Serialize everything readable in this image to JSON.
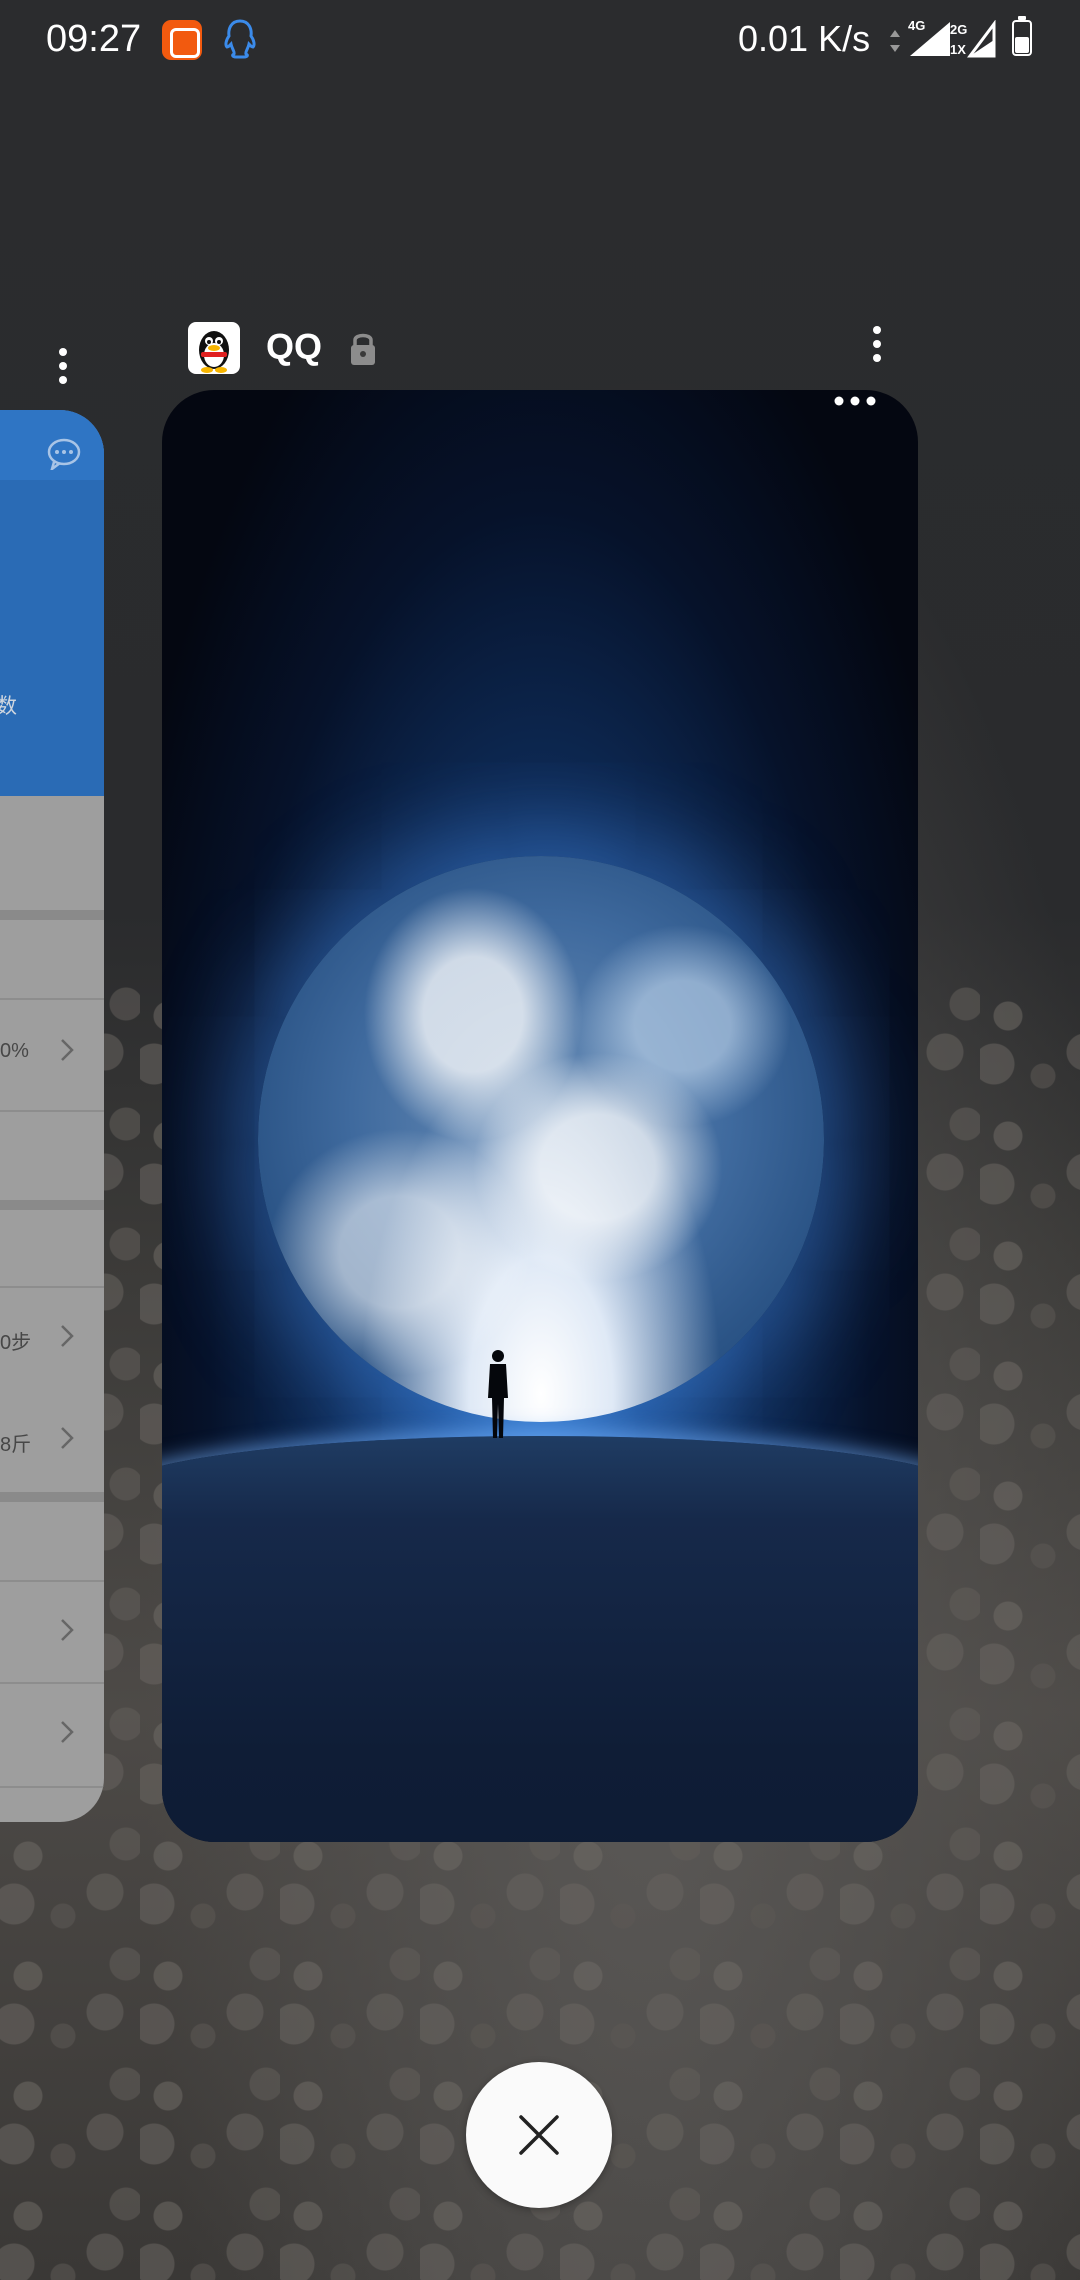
{
  "status_bar": {
    "time": "09:27",
    "net_speed": "0.01 K/s",
    "sim1_label": "4G",
    "sim2_label_top": "2G",
    "sim2_label_bottom": "1X",
    "icons": [
      "mi-icon",
      "qq-notification-icon",
      "data-arrows-icon",
      "signal-4g-icon",
      "signal-2g-icon",
      "battery-icon"
    ],
    "battery_level": 0.5
  },
  "recent_apps": {
    "left_card": {
      "texts": [
        "数",
        "0%",
        "0步",
        "8斤"
      ],
      "header_color": "#2a6bb5"
    },
    "current_card": {
      "app_name": "QQ",
      "locked": true,
      "icons": [
        "qq-app-icon",
        "lock-icon",
        "more-vertical-icon"
      ]
    }
  },
  "close_all": {
    "icon": "close-icon"
  }
}
